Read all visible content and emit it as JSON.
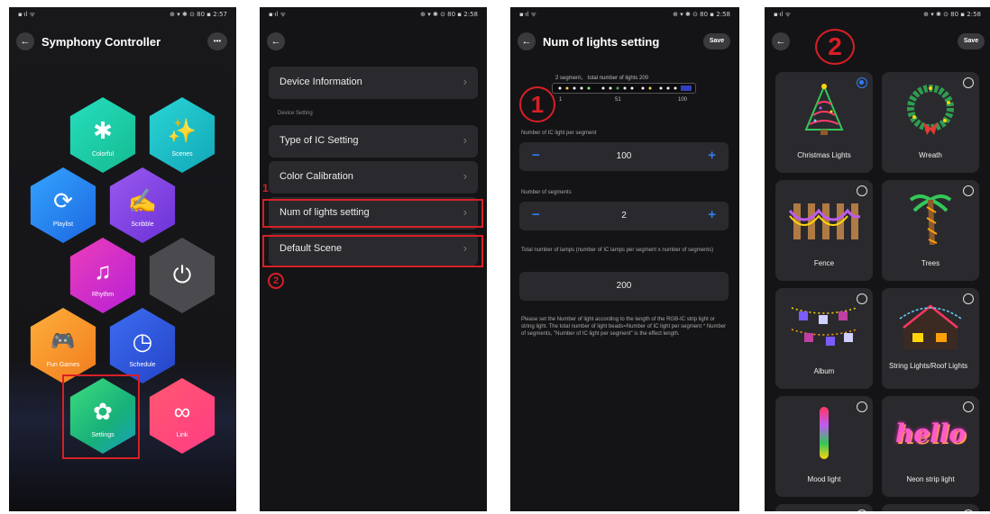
{
  "status_bar": {
    "left": "▪ᐧıl ᯤ",
    "right_p1": "⊕ ▾ ✱ ⊙ 80 ▪ 2:57",
    "right_p2": "⊕ ▾ ✱ ⊙ 80 ▪ 2:58"
  },
  "screen1": {
    "title": "Symphony Controller",
    "more": "•••",
    "tiles": [
      {
        "label": "Colorful",
        "icon": "✱"
      },
      {
        "label": "Scenes",
        "icon": "✨"
      },
      {
        "label": "Playlist",
        "icon": "⟳"
      },
      {
        "label": "Scribble",
        "icon": "✍"
      },
      {
        "label": "Rhythm",
        "icon": "♫"
      },
      {
        "label": "",
        "icon": "⏻"
      },
      {
        "label": "Fun Games",
        "icon": "🎮"
      },
      {
        "label": "Schedule",
        "icon": "◷"
      },
      {
        "label": "Settings",
        "icon": "✿"
      },
      {
        "label": "Link",
        "icon": "∞"
      }
    ]
  },
  "screen2": {
    "items": [
      {
        "label": "Device Information"
      },
      {
        "label": "Type of IC Setting"
      },
      {
        "label": "Color Calibration"
      },
      {
        "label": "Num of lights setting"
      },
      {
        "label": "Default Scene"
      }
    ],
    "section_label": "Device Setting",
    "marker1": "1",
    "marker2": "2"
  },
  "screen3": {
    "title": "Num of lights setting",
    "save": "Save",
    "strip_caption": "2 segment，  total number of lights 200",
    "strip_ticks": [
      "1",
      "51",
      "100"
    ],
    "marker": "1",
    "per_segment_label": "Number of IC light per segment",
    "per_segment_value": "100",
    "segments_label": "Number of segments",
    "segments_value": "2",
    "total_label": "Total number of lamps (number of IC lamps per segment x number of segments)",
    "total_value": "200",
    "minus": "−",
    "plus": "+",
    "note": "Please set the Number of light according to the length of the RGB-IC strip light or string light. The total number of light beads=Number of IC light per segment * Number of segments, \"Number of IC light per segment\" is the effect length."
  },
  "screen4": {
    "save": "Save",
    "marker": "2",
    "scenes": [
      {
        "name": "Christmas Lights",
        "selected": true
      },
      {
        "name": "Wreath",
        "selected": false
      },
      {
        "name": "Fence",
        "selected": false
      },
      {
        "name": "Trees",
        "selected": false
      },
      {
        "name": "Album",
        "selected": false
      },
      {
        "name": "String Lights/Roof Lights",
        "selected": false
      },
      {
        "name": "Mood light",
        "selected": false
      },
      {
        "name": "Neon strip light",
        "selected": false
      }
    ],
    "neon_text": "hello"
  },
  "icons": {
    "back": "←",
    "chevron": "›"
  },
  "colors": {
    "accent": "#2f7cf6",
    "highlight": "#d81f26",
    "background": "#141416",
    "card": "#2a2a2e"
  }
}
